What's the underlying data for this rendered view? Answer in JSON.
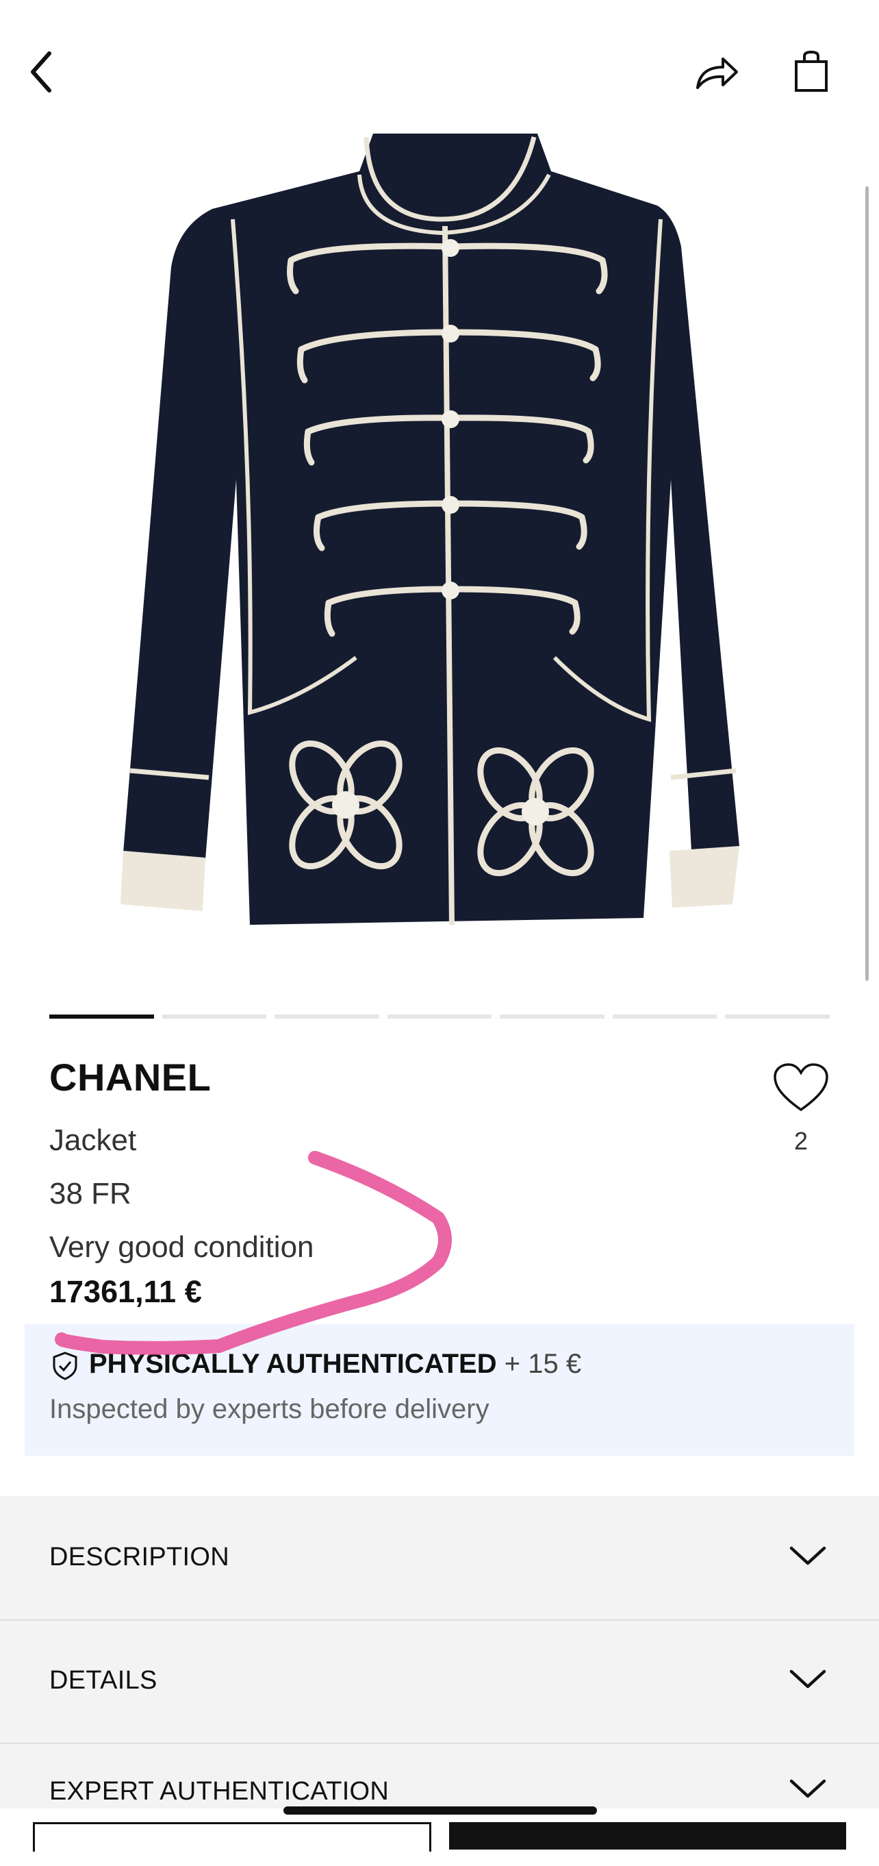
{
  "product": {
    "brand": "CHANEL",
    "type": "Jacket",
    "size": "38 FR",
    "condition": "Very good condition",
    "price": "17361,11 €",
    "favorites_count": "2"
  },
  "carousel": {
    "total_images": 7,
    "active_index": 0
  },
  "authentication": {
    "title": "PHYSICALLY AUTHENTICATED",
    "fee": "+ 15 €",
    "subtitle": "Inspected by experts before delivery"
  },
  "sections": [
    {
      "label": "DESCRIPTION"
    },
    {
      "label": "DETAILS"
    },
    {
      "label": "EXPERT AUTHENTICATION"
    }
  ],
  "icons": {
    "back": "chevron-left-icon",
    "share": "share-icon",
    "bag": "shopping-bag-icon",
    "favorite": "heart-icon",
    "auth": "shield-check-icon",
    "expand": "chevron-down-icon"
  },
  "colors": {
    "annotation": "#e8559b",
    "auth_bg": "#eff4fe",
    "jacket": "#161c2f",
    "trim": "#e9e4d6"
  }
}
